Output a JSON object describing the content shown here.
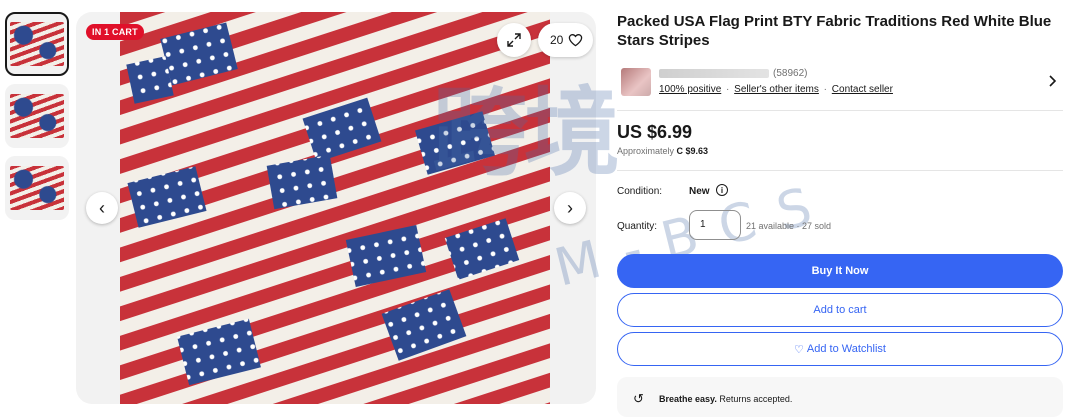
{
  "gallery": {
    "badge": "IN 1 CART",
    "watch_count": "20",
    "prev_glyph": "‹",
    "next_glyph": "›",
    "thumbnail_count": 3
  },
  "listing": {
    "title": "Packed USA Flag Print BTY Fabric Traditions Red White Blue Stars Stripes"
  },
  "seller": {
    "feedback_count": "(58962)",
    "positive": "100% positive",
    "other_items": "Seller's other items",
    "contact": "Contact seller",
    "sep": "·"
  },
  "price": {
    "main": "US $6.99",
    "approx_label": "Approximately ",
    "approx_value": "C $9.63"
  },
  "condition": {
    "label": "Condition:",
    "value": "New",
    "info_glyph": "i"
  },
  "quantity": {
    "label": "Quantity:",
    "value": "1",
    "availability": "21 available · 27 sold"
  },
  "buttons": {
    "buy_now": "Buy It Now",
    "add_to_cart": "Add to cart",
    "watch_heart": "♡",
    "add_to_watchlist": "Add to Watchlist"
  },
  "returns": {
    "icon_glyph": "↺",
    "bold": "Breathe easy.",
    "text": " Returns accepted."
  },
  "watermark": {
    "main": "跨境",
    "sub": "M-BCS"
  },
  "colors": {
    "accent": "#3665f3",
    "badge_red": "#e0102a",
    "flag_red": "#c8323a",
    "flag_blue": "#2e4a8f"
  },
  "icons": [
    "expand-icon",
    "heart-icon",
    "chevron-left-icon",
    "chevron-right-icon",
    "info-icon",
    "return-icon"
  ]
}
